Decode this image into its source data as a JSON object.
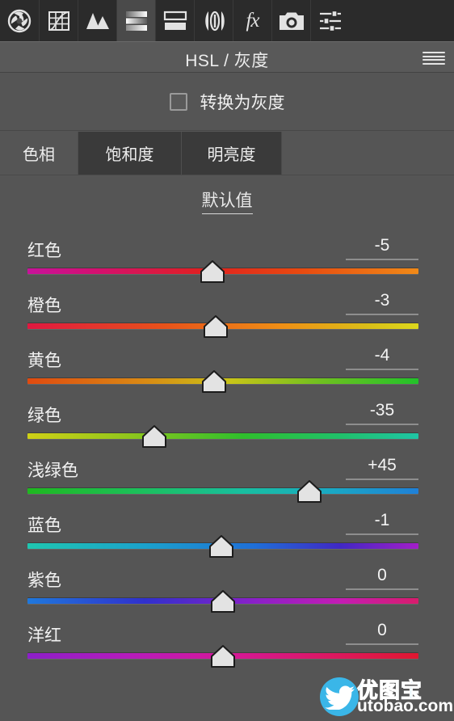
{
  "toolbar": {
    "items": [
      {
        "name": "aperture-icon",
        "label": "基本"
      },
      {
        "name": "tone-curve-icon",
        "label": "色调曲线"
      },
      {
        "name": "hsl-grayscale-icon",
        "label": "HSL/灰度"
      },
      {
        "name": "split-toning-icon",
        "label": "分离色调"
      },
      {
        "name": "detail-icon",
        "label": "细节"
      },
      {
        "name": "lens-corrections-icon",
        "label": "镜头校正"
      },
      {
        "name": "effects-fx-icon",
        "label": "fx"
      },
      {
        "name": "camera-calibration-icon",
        "label": "相机校准"
      },
      {
        "name": "presets-sliders-icon",
        "label": "预设"
      }
    ],
    "active_index": 3,
    "fx_glyph": "fx"
  },
  "header": {
    "title": "HSL / 灰度",
    "menu_icon": "hamburger-icon"
  },
  "grayscale": {
    "checkbox_label": "转换为灰度",
    "checked": false
  },
  "tabs": [
    {
      "label": "色相",
      "active": true
    },
    {
      "label": "饱和度",
      "active": false
    },
    {
      "label": "明亮度",
      "active": false
    }
  ],
  "default_link": "默认值",
  "sliders": [
    {
      "label": "红色",
      "value": "-5",
      "pos": 47.3,
      "gradient": "linear-gradient(to right,#c8129b 0%,#d4106f 18%,#e02020 45%,#e84a10 70%,#f08a18 100%)"
    },
    {
      "label": "橙色",
      "value": "-3",
      "pos": 48.2,
      "gradient": "linear-gradient(to right,#e01840 0%,#e8521a 35%,#ef8f16 65%,#d9c018 88%,#ddd81c 100%)"
    },
    {
      "label": "黄色",
      "value": "-4",
      "pos": 47.7,
      "gradient": "linear-gradient(to right,#e04a10 0%,#d98a14 30%,#c8c418 52%,#6fc020 75%,#22c22a 100%)"
    },
    {
      "label": "绿色",
      "value": "-35",
      "pos": 32.4,
      "gradient": "linear-gradient(to right,#cfd016 0%,#93c61c 25%,#2fbf2c 55%,#20c06a 80%,#1fc5a5 100%)"
    },
    {
      "label": "浅绿色",
      "value": "+45",
      "pos": 72.2,
      "gradient": "linear-gradient(to right,#1fb81f 0%,#1cc05a 28%,#18bfa0 55%,#1aa8c4 78%,#1f80d8 100%)"
    },
    {
      "label": "蓝色",
      "value": "-1",
      "pos": 49.6,
      "gradient": "linear-gradient(to right,#1fc6b0 0%,#1ba2cc 30%,#1f6fd8 58%,#4028c4 80%,#a41ec8 100%)"
    },
    {
      "label": "紫色",
      "value": "0",
      "pos": 50.0,
      "gradient": "linear-gradient(to right,#1f78dc 0%,#3030cc 30%,#8a20c8 58%,#c41cb4 80%,#d81c6c 100%)"
    },
    {
      "label": "洋红",
      "value": "0",
      "pos": 50.0,
      "gradient": "linear-gradient(to right,#8c1fc8 0%,#b41cbc 25%,#d4189c 50%,#dc1860 78%,#e01830 100%)"
    }
  ],
  "watermark": {
    "chinese": "优图宝",
    "domain": "utobao.com",
    "logo_icon": "twitter-bird-icon",
    "accent": "#3ab6e8"
  }
}
